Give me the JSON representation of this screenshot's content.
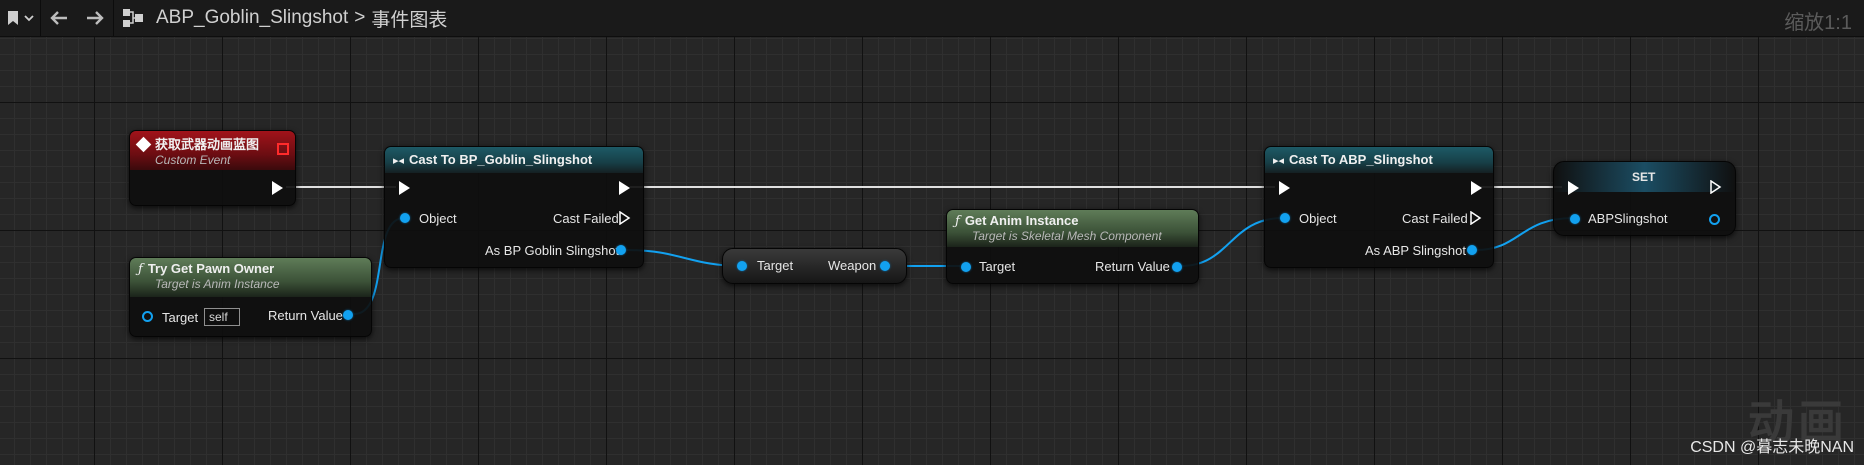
{
  "topbar": {
    "breadcrumb_asset": "ABP_Goblin_Slingshot",
    "breadcrumb_sep": ">",
    "breadcrumb_graph": "事件图表",
    "zoom": "缩放1:1"
  },
  "nodes": {
    "custom_event": {
      "title": "获取武器动画蓝图",
      "subtitle": "Custom Event"
    },
    "try_get_pawn": {
      "title": "Try Get Pawn Owner",
      "subtitle": "Target is Anim Instance",
      "in_label": "Target",
      "in_value": "self",
      "out_label": "Return Value"
    },
    "cast_goblin": {
      "title": "Cast To BP_Goblin_Slingshot",
      "object_label": "Object",
      "failed_label": "Cast Failed",
      "as_label": "As BP Goblin Slingshot"
    },
    "weapon_get": {
      "in_label": "Target",
      "out_label": "Weapon"
    },
    "get_anim": {
      "title": "Get Anim Instance",
      "subtitle": "Target is Skeletal Mesh Component",
      "in_label": "Target",
      "out_label": "Return Value"
    },
    "cast_abp": {
      "title": "Cast To ABP_Slingshot",
      "object_label": "Object",
      "failed_label": "Cast Failed",
      "as_label": "As ABP Slingshot"
    },
    "set_node": {
      "title": "SET",
      "in_label": "ABPSlingshot"
    }
  },
  "watermark": {
    "text": "CSDN @暮志未晚NAN",
    "big": "动画"
  },
  "colors": {
    "object_pin": "#12a1f0",
    "exec_pin": "#ffffff",
    "event_header": "#a1131a",
    "cast_header": "#1d5a66",
    "function_header": "#5f7c58"
  }
}
